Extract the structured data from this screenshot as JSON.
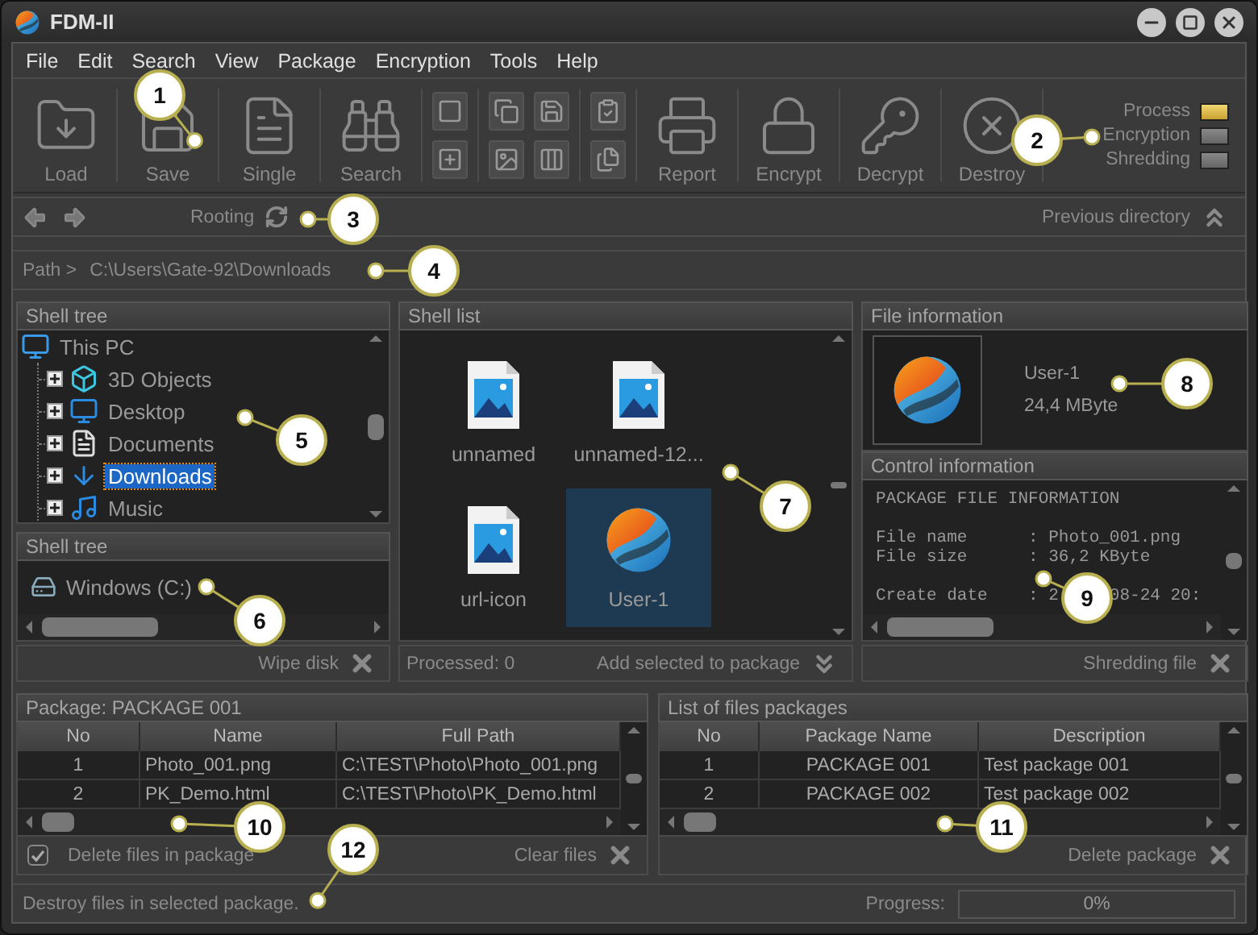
{
  "window": {
    "title": "FDM-II"
  },
  "menu": [
    "File",
    "Edit",
    "Search",
    "View",
    "Package",
    "Encryption",
    "Tools",
    "Help"
  ],
  "toolbar_left": [
    "Load",
    "Save",
    "Single",
    "Search"
  ],
  "toolbar_right": [
    "Report",
    "Encrypt",
    "Decrypt",
    "Destroy"
  ],
  "indicators": [
    {
      "label": "Process",
      "on": true
    },
    {
      "label": "Encryption",
      "on": false
    },
    {
      "label": "Shredding",
      "on": false
    }
  ],
  "nav": {
    "rooting": "Rooting",
    "previous": "Previous directory"
  },
  "path": {
    "label": "Path >",
    "value": "C:\\Users\\Gate-92\\Downloads"
  },
  "shell_tree": {
    "title": "Shell tree",
    "root": "This PC",
    "children": [
      {
        "label": "3D Objects",
        "kind": "cube",
        "expanded": false,
        "selected": false
      },
      {
        "label": "Desktop",
        "kind": "desktop",
        "expanded": false,
        "selected": false
      },
      {
        "label": "Documents",
        "kind": "document",
        "expanded": false,
        "selected": false
      },
      {
        "label": "Downloads",
        "kind": "download",
        "expanded": false,
        "selected": true
      },
      {
        "label": "Music",
        "kind": "music",
        "expanded": false,
        "selected": false
      }
    ]
  },
  "drives": {
    "title": "Shell tree",
    "items": [
      "Windows (C:)"
    ],
    "action": "Wipe disk"
  },
  "shell_list": {
    "title": "Shell list",
    "items": [
      {
        "label": "unnamed",
        "kind": "image",
        "selected": false
      },
      {
        "label": "unnamed-12...",
        "kind": "image",
        "selected": false
      },
      {
        "label": "url-icon",
        "kind": "image",
        "selected": false
      },
      {
        "label": "User-1",
        "kind": "logo",
        "selected": true
      }
    ],
    "status": "Processed: 0",
    "action": "Add selected to package"
  },
  "file_info": {
    "title": "File information",
    "name": "User-1",
    "size": "24,4 MByte"
  },
  "control_info": {
    "title": "Control information",
    "action": "Shredding file",
    "lines": [
      {
        "kind": "heading",
        "text": "PACKAGE FILE INFORMATION"
      },
      {
        "kind": "field",
        "label": "File name",
        "value": ": Photo_001.png"
      },
      {
        "kind": "field",
        "label": "File size",
        "value": ": 36,2 KByte"
      },
      {
        "kind": "split",
        "label": "Create date",
        "value": ": 2",
        "tail": "08-24 20:"
      }
    ]
  },
  "package": {
    "title": "Package: PACKAGE 001",
    "columns": [
      "No",
      "Name",
      "Full Path"
    ],
    "rows": [
      [
        "1",
        "Photo_001.png",
        "C:\\TEST\\Photo\\Photo_001.png"
      ],
      [
        "2",
        "PK_Demo.html",
        "C:\\TEST\\Photo\\PK_Demo.html"
      ]
    ],
    "checkbox": {
      "label": "Delete files in package",
      "checked": true
    },
    "action": "Clear files"
  },
  "packages": {
    "title": "List of files packages",
    "columns": [
      "No",
      "Package Name",
      "Description"
    ],
    "rows": [
      [
        "1",
        "PACKAGE 001",
        "Test package 001"
      ],
      [
        "2",
        "PACKAGE 002",
        "Test package 002"
      ]
    ],
    "action": "Delete package"
  },
  "status_bar": {
    "message": "Destroy files in selected package.",
    "progress_label": "Progress:",
    "progress": "0%",
    "level": 0
  },
  "callouts": [
    "1",
    "2",
    "3",
    "4",
    "5",
    "6",
    "7",
    "8",
    "9",
    "10",
    "11",
    "12"
  ]
}
